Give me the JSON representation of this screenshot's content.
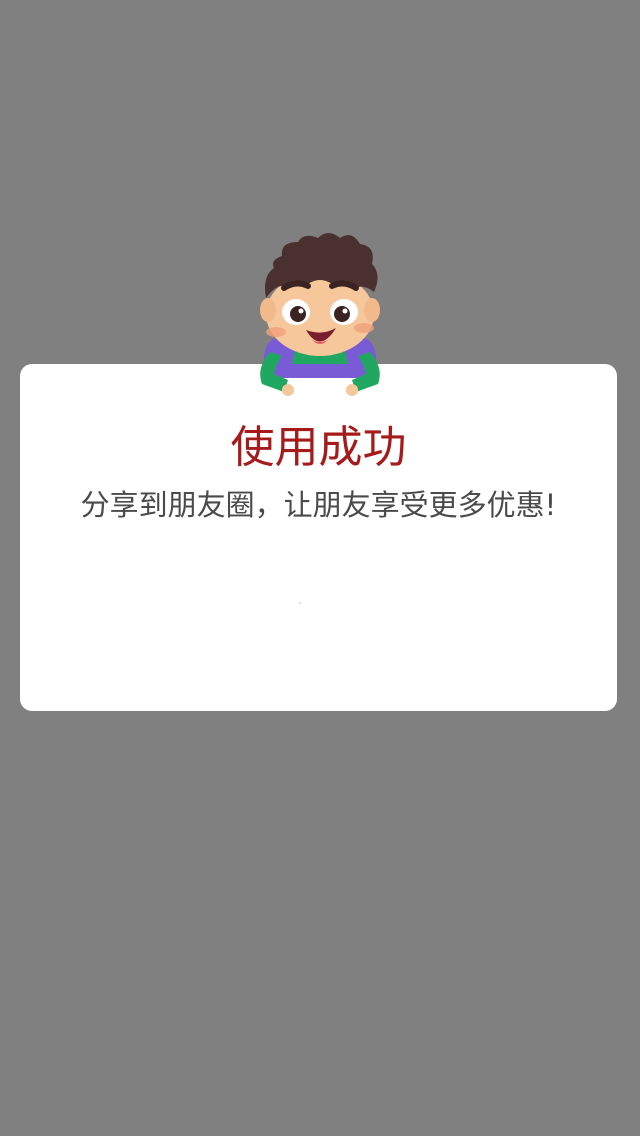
{
  "dialog": {
    "title": "使用成功",
    "message": "分享到朋友圈，让朋友享受更多优惠!"
  },
  "colors": {
    "overlay": "#808080",
    "card": "#ffffff",
    "title": "#a51b1b",
    "message": "#4a4a4a"
  },
  "mascot": {
    "icon": "cartoon-boy-icon"
  }
}
